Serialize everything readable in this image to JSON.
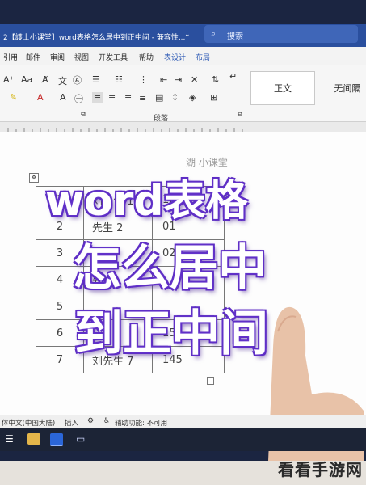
{
  "titlebar": {
    "title": "2【護士小课堂】word表格怎么居中到正中间 - 兼容性...",
    "search_placeholder": "搜索"
  },
  "menu": [
    "引用",
    "邮件",
    "审阅",
    "视图",
    "开发工具",
    "帮助",
    "表设计",
    "布局"
  ],
  "ribbon": {
    "group_label": "段落",
    "styles": [
      "正文",
      "无间隔"
    ]
  },
  "table": {
    "header_faint": "湖 小课堂",
    "rows": [
      [
        "1",
        "刘先生 1",
        "105"
      ],
      [
        "2",
        "先生 2",
        "01"
      ],
      [
        "3",
        "",
        "02"
      ],
      [
        "4",
        "先生",
        ""
      ],
      [
        "5",
        "",
        ""
      ],
      [
        "6",
        "",
        "150"
      ],
      [
        "7",
        "刘先生 7",
        "145"
      ]
    ]
  },
  "overlay": {
    "line1": "word表格",
    "line2": "怎么居中",
    "line3": "到正中间"
  },
  "status": {
    "language": "体中文(中国大陆)",
    "mode": "插入",
    "accessibility": "辅助功能: 不可用"
  },
  "watermark": "看看手游网"
}
